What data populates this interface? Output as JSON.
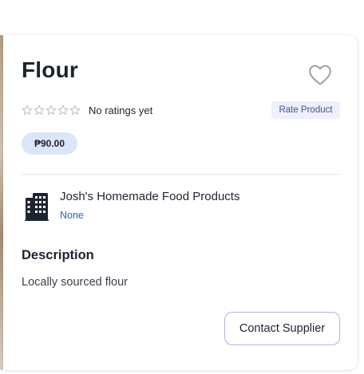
{
  "product": {
    "title": "Flour",
    "favorite_icon": "heart-outline-icon",
    "rating": {
      "stars_total": 5,
      "stars_filled": 0,
      "text": "No ratings yet",
      "rate_button_label": "Rate Product"
    },
    "price": "₱90.00"
  },
  "supplier": {
    "icon": "building-icon",
    "name": "Josh's Homemade Food Products",
    "subtitle": "None"
  },
  "description": {
    "heading": "Description",
    "text": "Locally sourced flour"
  },
  "actions": {
    "contact_label": "Contact Supplier"
  },
  "colors": {
    "price_badge_bg": "#dbe6fb",
    "rate_button_bg": "#eef0fb",
    "link": "#2a63c8",
    "contact_border": "#aeb5e6"
  }
}
